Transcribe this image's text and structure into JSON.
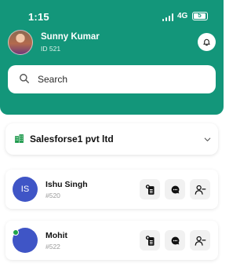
{
  "status_bar": {
    "time": "1:15",
    "network": "4G",
    "battery": "5"
  },
  "profile": {
    "name": "Sunny Kumar",
    "id_label": "ID 521"
  },
  "search": {
    "placeholder": "Search"
  },
  "company": {
    "name": "Salesforse1 pvt ltd"
  },
  "employees": [
    {
      "initials": "IS",
      "name": "Ishu Singh",
      "id": "#520",
      "online": false
    },
    {
      "initials": "",
      "name": "Mohit",
      "id": "#522",
      "online": true
    }
  ],
  "colors": {
    "brand": "#13967a",
    "avatar": "#3f55c6",
    "online": "#1fa34a"
  },
  "icons": {
    "bell": "bell-icon",
    "search": "search-icon",
    "company": "building-icon",
    "dropdown": "chevron-down-icon",
    "action1": "assign-task-icon",
    "action2": "chat-icon",
    "action3": "remove-user-icon"
  }
}
